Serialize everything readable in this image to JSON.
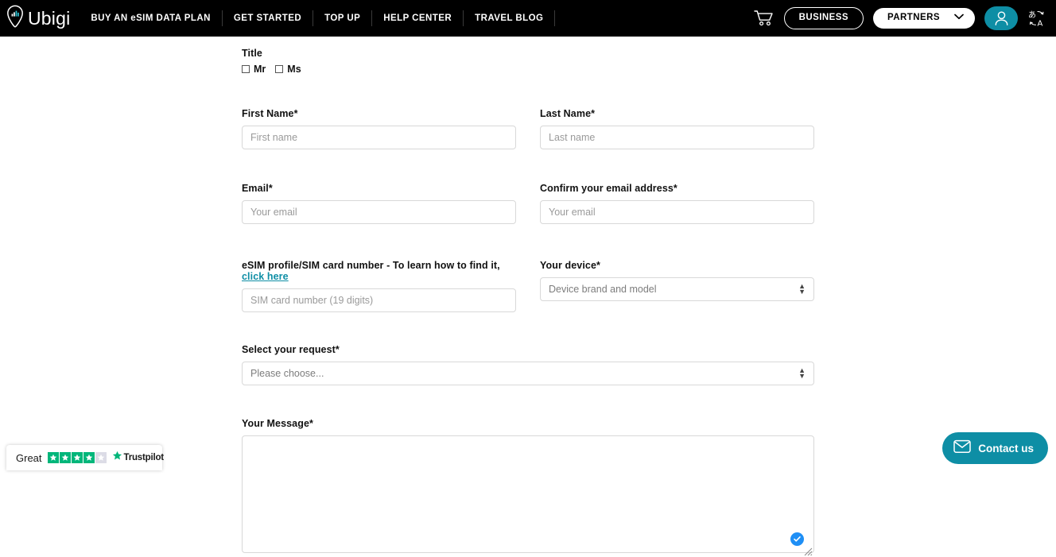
{
  "navbar": {
    "logo_text": "Ubigi",
    "links": [
      {
        "label": "BUY AN eSIM DATA PLAN"
      },
      {
        "label": "GET STARTED"
      },
      {
        "label": "TOP UP"
      },
      {
        "label": "HELP CENTER"
      },
      {
        "label": "TRAVEL BLOG"
      }
    ],
    "cart_icon": "shopping-cart-icon",
    "business_label": "BUSINESS",
    "partners_label": "PARTNERS",
    "partners_chevron": "chevron-down-icon",
    "account_icon": "user-account-icon",
    "language_icon": "language-translate-icon",
    "accent_color": "#0e8ea5",
    "background_color": "#000000"
  },
  "form": {
    "title": {
      "label": "Title",
      "options": [
        {
          "label": "Mr",
          "checked": false
        },
        {
          "label": "Ms",
          "checked": false
        }
      ]
    },
    "first_name": {
      "label": "First Name*",
      "placeholder": "First name",
      "value": ""
    },
    "last_name": {
      "label": "Last Name*",
      "placeholder": "Last name",
      "value": ""
    },
    "email": {
      "label": "Email*",
      "placeholder": "Your email",
      "value": ""
    },
    "confirm_email": {
      "label": "Confirm your email address*",
      "placeholder": "Your email",
      "value": ""
    },
    "sim_number": {
      "label_prefix": "eSIM profile/SIM card number - To learn how to find it,",
      "label_link": "click here",
      "placeholder": "SIM card number (19 digits)",
      "value": ""
    },
    "device": {
      "label": "Your device*",
      "selected": "Device brand and model"
    },
    "request": {
      "label": "Select your request*",
      "selected": "Please choose..."
    },
    "message": {
      "label": "Your Message*",
      "value": "",
      "placeholder": ""
    }
  },
  "trustpilot": {
    "rating_word": "Great",
    "stars_filled": 4,
    "stars_total": 5,
    "brand": "Trustpilot",
    "star_color": "#00b67a",
    "star_empty_color": "#dcdce6"
  },
  "contact_widget": {
    "label": "Contact us",
    "icon": "envelope-icon",
    "color": "#0e8ea5"
  }
}
